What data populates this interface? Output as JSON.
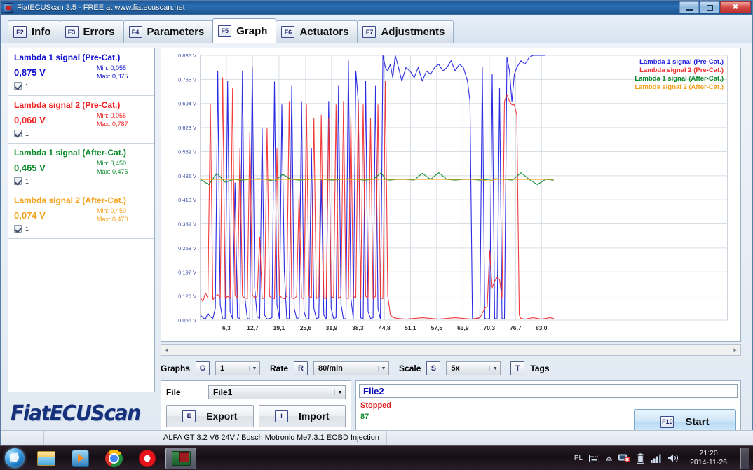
{
  "window": {
    "title": "FiatECUScan 3.5 - FREE at www.fiatecuscan.net",
    "minimize_label": "",
    "maximize_label": "",
    "close_label": "✖"
  },
  "tabs": [
    {
      "key": "F2",
      "label": "Info",
      "active": false
    },
    {
      "key": "F3",
      "label": "Errors",
      "active": false
    },
    {
      "key": "F4",
      "label": "Parameters",
      "active": false
    },
    {
      "key": "F5",
      "label": "Graph",
      "active": true
    },
    {
      "key": "F6",
      "label": "Actuators",
      "active": false
    },
    {
      "key": "F7",
      "label": "Adjustments",
      "active": false
    }
  ],
  "sidebar": {
    "signals": [
      {
        "name": "Lambda 1 signal (Pre-Cat.)",
        "value": "0,875 V",
        "min": "Min: 0,055",
        "max": "Max: 0,875",
        "color": "#0d0dd0",
        "checked": true,
        "check_label": "1"
      },
      {
        "name": "Lambda signal 2 (Pre-Cat.)",
        "value": "0,060 V",
        "min": "Min: 0,055",
        "max": "Max: 0,787",
        "color": "#f02020",
        "checked": true,
        "check_label": "1"
      },
      {
        "name": "Lambda 1 signal (After-Cat.)",
        "value": "0,465 V",
        "min": "Min: 0,450",
        "max": "Max: 0,475",
        "color": "#0a8a2a",
        "checked": true,
        "check_label": "1"
      },
      {
        "name": "Lambda signal 2 (After-Cat.)",
        "value": "0,074 V",
        "min": "Min: 0,450",
        "max": "Max: 0,470",
        "color": "#f5a21e",
        "checked": true,
        "check_label": "1"
      }
    ],
    "logo": "FiatECUScan"
  },
  "chart_data": {
    "type": "line",
    "title": "",
    "xlabel": "",
    "ylabel": "V",
    "grid": true,
    "legend_position": "top-right",
    "xlim": [
      0,
      86.2
    ],
    "ylim": [
      0.055,
      0.836
    ],
    "xticks": [
      "6,3",
      "12,7",
      "19,1",
      "25,6",
      "31,9",
      "38,3",
      "44,8",
      "51,1",
      "57,5",
      "63,9",
      "70,3",
      "76,7",
      "83,0"
    ],
    "xtick_values": [
      6.3,
      12.7,
      19.1,
      25.6,
      31.9,
      38.3,
      44.8,
      51.1,
      57.5,
      63.9,
      70.3,
      76.7,
      83.0
    ],
    "yticks": [
      "0,836 V",
      "0,765 V",
      "0,694 V",
      "0,623 V",
      "0,552 V",
      "0,481 V",
      "0,410 V",
      "0,339 V",
      "0,268 V",
      "0,197 V",
      "0,126 V",
      "0,055 V"
    ],
    "ytick_values": [
      0.836,
      0.765,
      0.694,
      0.623,
      0.552,
      0.481,
      0.41,
      0.339,
      0.268,
      0.197,
      0.126,
      0.055
    ],
    "series": [
      {
        "name": "Lambda 1 signal (Pre-Cat.)",
        "color": "#2020e0",
        "x": [
          0,
          0.6,
          1.2,
          1.8,
          2.4,
          3.0,
          3.6,
          4.2,
          4.8,
          5.4,
          6.0,
          6.6,
          7.2,
          7.8,
          8.4,
          9.0,
          9.6,
          10.2,
          10.8,
          11.4,
          12.0,
          12.6,
          13.2,
          13.8,
          14.4,
          15.0,
          15.6,
          16.2,
          16.8,
          17.4,
          18.0,
          18.6,
          19.2,
          19.8,
          20.4,
          21.0,
          21.6,
          22.2,
          22.8,
          23.4,
          24.0,
          24.6,
          25.2,
          25.8,
          26.4,
          27.0,
          27.6,
          28.2,
          28.8,
          29.4,
          30.0,
          30.6,
          31.2,
          31.8,
          32.4,
          33.0,
          33.6,
          34.2,
          34.8,
          35.4,
          36.0,
          36.6,
          37.2,
          37.8,
          38.4,
          39.0,
          39.6,
          40.2,
          40.8,
          41.4,
          42.0,
          42.6,
          43.2,
          43.8,
          44.4,
          45.0,
          45.6,
          46.2,
          46.8,
          47.4,
          48.0,
          49.0,
          50.0,
          51.0,
          52.0,
          53.0,
          54.0,
          55.0,
          56.0,
          57.0,
          58.0,
          59.0,
          60.0,
          61.0,
          62.0,
          63.0,
          64.0,
          65.0,
          65.6,
          66.2,
          66.8,
          67.4,
          68.0,
          68.6,
          69.2,
          69.8,
          70.4,
          71.0,
          71.6,
          72.2,
          72.8,
          73.4,
          74.0,
          74.6,
          75.2,
          75.8,
          76.4,
          77.0,
          78.0,
          79.0,
          80.0,
          81.0,
          82.0,
          83.0,
          84.0,
          85.0,
          86.0
        ],
        "y": [
          0.07,
          0.062,
          0.058,
          0.075,
          0.065,
          0.06,
          0.09,
          0.79,
          0.1,
          0.058,
          0.06,
          0.76,
          0.08,
          0.06,
          0.46,
          0.062,
          0.06,
          0.79,
          0.12,
          0.06,
          0.058,
          0.8,
          0.15,
          0.065,
          0.06,
          0.62,
          0.07,
          0.058,
          0.06,
          0.062,
          0.758,
          0.1,
          0.06,
          0.69,
          0.2,
          0.06,
          0.058,
          0.745,
          0.09,
          0.06,
          0.062,
          0.7,
          0.08,
          0.058,
          0.06,
          0.56,
          0.09,
          0.06,
          0.062,
          0.47,
          0.07,
          0.058,
          0.7,
          0.09,
          0.06,
          0.062,
          0.745,
          0.1,
          0.058,
          0.06,
          0.82,
          0.12,
          0.06,
          0.79,
          0.7,
          0.062,
          0.058,
          0.76,
          0.08,
          0.06,
          0.062,
          0.745,
          0.09,
          0.058,
          0.836,
          0.8,
          0.79,
          0.81,
          0.77,
          0.836,
          0.81,
          0.76,
          0.8,
          0.79,
          0.77,
          0.8,
          0.76,
          0.79,
          0.78,
          0.8,
          0.81,
          0.79,
          0.8,
          0.82,
          0.79,
          0.81,
          0.8,
          0.76,
          0.7,
          0.06,
          0.058,
          0.06,
          0.062,
          0.8,
          0.06,
          0.058,
          0.06,
          0.78,
          0.06,
          0.058,
          0.74,
          0.06,
          0.058,
          0.83,
          0.79,
          0.7,
          0.78,
          0.8,
          0.82,
          0.81,
          0.83,
          0.836,
          0.836,
          0.836,
          0.836
        ]
      },
      {
        "name": "Lambda signal 2 (Pre-Cat.)",
        "color": "#f03030",
        "x": [
          0,
          0.6,
          1.2,
          1.8,
          2.4,
          3.0,
          3.6,
          4.2,
          4.8,
          5.4,
          6.0,
          6.6,
          7.2,
          7.8,
          8.4,
          9.0,
          9.6,
          10.2,
          10.8,
          11.4,
          12.0,
          12.6,
          13.2,
          13.8,
          14.4,
          15.0,
          15.6,
          16.2,
          16.8,
          17.4,
          18.0,
          18.6,
          19.2,
          19.8,
          20.4,
          21.0,
          21.6,
          22.2,
          22.8,
          23.4,
          24.0,
          24.6,
          25.2,
          25.8,
          26.4,
          27.0,
          27.6,
          28.2,
          28.8,
          29.4,
          30.0,
          30.6,
          31.2,
          31.8,
          32.4,
          33.0,
          33.6,
          34.2,
          34.8,
          35.4,
          36.0,
          36.6,
          37.2,
          37.8,
          38.4,
          39.0,
          39.6,
          40.2,
          40.8,
          41.4,
          42.0,
          42.6,
          43.2,
          43.8,
          44.4,
          45.0,
          45.6,
          46.2,
          47.0,
          48.0,
          50.0,
          52.0,
          54.0,
          56.0,
          58.0,
          60.0,
          62.0,
          64.0,
          66.0,
          67.0,
          68.0,
          68.6,
          69.2,
          69.8,
          70.4,
          71.0,
          71.6,
          72.2,
          72.8,
          73.4,
          74.0,
          74.6,
          75.2,
          75.8,
          76.4,
          77.0,
          77.6,
          78.0,
          79.0,
          80.0,
          81.0,
          82.0,
          83.0,
          84.0,
          85.0,
          86.0
        ],
        "y": [
          0.12,
          0.11,
          0.135,
          0.12,
          0.69,
          0.115,
          0.125,
          0.13,
          0.12,
          0.77,
          0.118,
          0.125,
          0.12,
          0.74,
          0.13,
          0.12,
          0.56,
          0.125,
          0.12,
          0.118,
          0.61,
          0.13,
          0.12,
          0.125,
          0.3,
          0.118,
          0.12,
          0.62,
          0.125,
          0.12,
          0.118,
          0.56,
          0.13,
          0.12,
          0.118,
          0.125,
          0.7,
          0.12,
          0.118,
          0.125,
          0.43,
          0.12,
          0.118,
          0.69,
          0.125,
          0.12,
          0.65,
          0.118,
          0.125,
          0.66,
          0.12,
          0.118,
          0.65,
          0.125,
          0.12,
          0.69,
          0.118,
          0.125,
          0.7,
          0.12,
          0.118,
          0.66,
          0.125,
          0.12,
          0.7,
          0.118,
          0.69,
          0.125,
          0.12,
          0.65,
          0.118,
          0.125,
          0.69,
          0.12,
          0.118,
          0.76,
          0.125,
          0.07,
          0.062,
          0.06,
          0.058,
          0.06,
          0.062,
          0.06,
          0.058,
          0.06,
          0.062,
          0.06,
          0.058,
          0.06,
          0.062,
          0.075,
          0.09,
          0.095,
          0.26,
          0.15,
          0.17,
          0.18,
          0.175,
          0.12,
          0.7,
          0.72,
          0.7,
          0.69,
          0.69,
          0.66,
          0.07,
          0.06,
          0.058,
          0.06,
          0.062,
          0.06,
          0.058,
          0.06,
          0.062,
          0.06
        ]
      },
      {
        "name": "Lambda 1 signal (After-Cat.)",
        "color": "#0a8a2a",
        "x": [
          0,
          2,
          4,
          6,
          8,
          10,
          12,
          14,
          16,
          18,
          20,
          22,
          24,
          26,
          28,
          30,
          32,
          34,
          36,
          38,
          40,
          42,
          44,
          45,
          46,
          48,
          50,
          52,
          54,
          56,
          58,
          60,
          62,
          64,
          66,
          68,
          70,
          72,
          74,
          76,
          78,
          80,
          82,
          84,
          86
        ],
        "y": [
          0.47,
          0.455,
          0.488,
          0.462,
          0.47,
          0.468,
          0.47,
          0.472,
          0.47,
          0.465,
          0.485,
          0.47,
          0.468,
          0.47,
          0.47,
          0.47,
          0.468,
          0.47,
          0.472,
          0.47,
          0.468,
          0.47,
          0.49,
          0.47,
          0.468,
          0.47,
          0.47,
          0.468,
          0.488,
          0.47,
          0.49,
          0.47,
          0.468,
          0.47,
          0.47,
          0.468,
          0.47,
          0.472,
          0.47,
          0.468,
          0.49,
          0.47,
          0.455,
          0.47,
          0.468
        ]
      },
      {
        "name": "Lambda signal 2 (After-Cat.)",
        "color": "#f5a21e",
        "x": [
          0,
          4,
          8,
          12,
          16,
          20,
          24,
          28,
          32,
          36,
          40,
          44,
          48,
          52,
          56,
          60,
          64,
          68,
          70,
          72,
          74,
          76,
          78,
          80,
          82,
          84,
          86
        ],
        "y": [
          0.47,
          0.47,
          0.47,
          0.47,
          0.47,
          0.47,
          0.47,
          0.47,
          0.47,
          0.47,
          0.47,
          0.47,
          0.47,
          0.47,
          0.47,
          0.47,
          0.47,
          0.47,
          0.465,
          0.47,
          0.47,
          0.47,
          0.47,
          0.47,
          0.47,
          0.47,
          0.47
        ]
      }
    ]
  },
  "controls": {
    "graphs_label": "Graphs",
    "graphs_key": "G",
    "graphs_value": "1",
    "rate_label": "Rate",
    "rate_key": "R",
    "rate_value": "80/min",
    "scale_label": "Scale",
    "scale_key": "S",
    "scale_value": "5x",
    "tags_key": "T",
    "tags_label": "Tags"
  },
  "file_panel": {
    "file_label": "File",
    "file_value": "File1",
    "export_key": "E",
    "export_label": "Export",
    "import_key": "I",
    "import_label": "Import"
  },
  "status_panel": {
    "file2_value": "File2",
    "state": "Stopped",
    "count": "87",
    "start_key": "F10",
    "start_label": "Start"
  },
  "statusbar": {
    "cell1": "",
    "cell2": "",
    "cell3": "",
    "vehicle": "ALFA GT 3.2 V6 24V / Bosch Motronic Me7.3.1 EOBD Injection"
  },
  "taskbar": {
    "items": [
      {
        "name": "start-orb",
        "label": ""
      },
      {
        "name": "explorer",
        "label": ""
      },
      {
        "name": "media-player",
        "label": ""
      },
      {
        "name": "chrome",
        "label": ""
      },
      {
        "name": "opera",
        "label": ""
      },
      {
        "name": "fiatecuscan",
        "label": ""
      }
    ],
    "lang": "PL",
    "time": "21:20",
    "date": "2014-11-26"
  },
  "scrollbar": {
    "left_arrow": "◄",
    "right_arrow": "►"
  }
}
